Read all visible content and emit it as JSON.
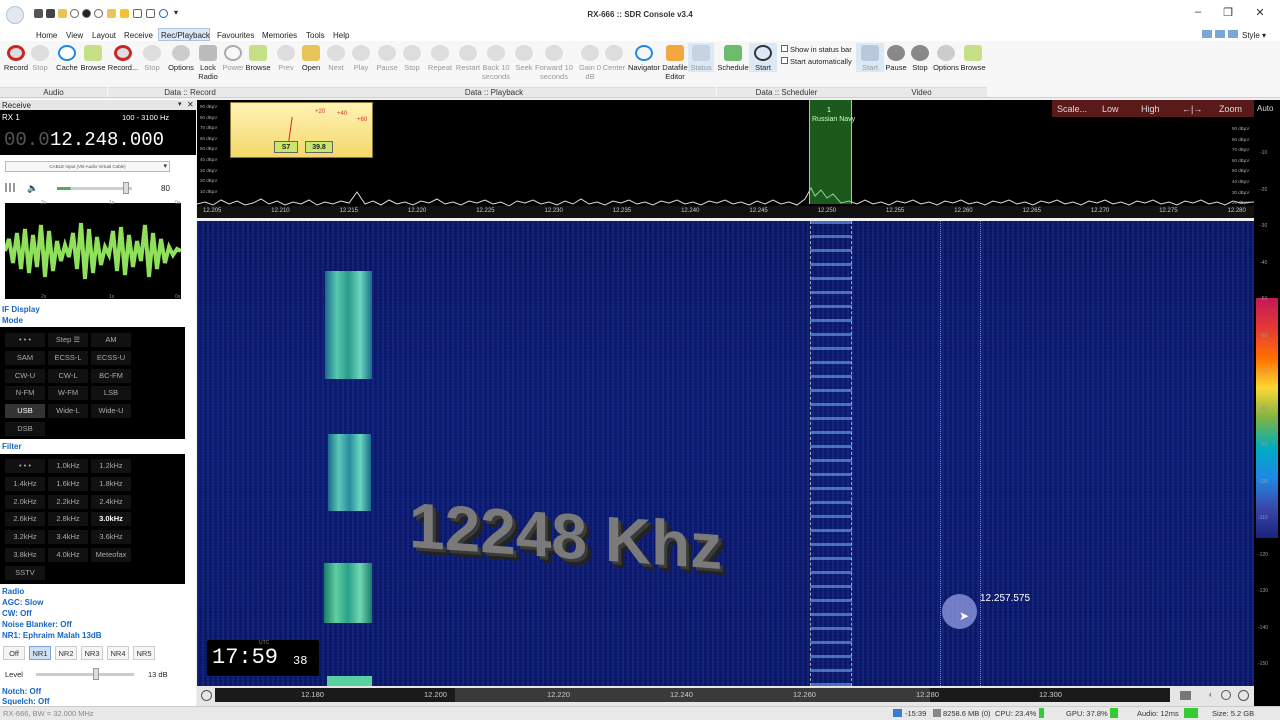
{
  "window": {
    "title": "RX-666 :: SDR Console v3.4",
    "style_label": "Style"
  },
  "menu": [
    "Home",
    "View",
    "Layout",
    "Receive",
    "Rec/Playback",
    "Favourites",
    "Memories",
    "Tools",
    "Help"
  ],
  "ribbon": {
    "audio": [
      "Record",
      "Stop",
      "Cache",
      "Browse"
    ],
    "data_record": [
      "Record...",
      "Stop",
      "Options",
      "Lock Radio",
      "Power",
      "Browse"
    ],
    "playback": [
      "Prev",
      "Open",
      "Next",
      "Play",
      "Pause",
      "Stop",
      "Repeat",
      "Restart",
      "Back 10 seconds",
      "Seek",
      "Forward 10 seconds",
      "Gain 0 dB",
      "Center",
      "Navigator",
      "Datafile Editor",
      "Status"
    ],
    "scheduler": [
      "Schedule",
      "Start"
    ],
    "scheduler_opts": [
      "Show in status bar",
      "Start automatically"
    ],
    "video": [
      "Start",
      "Pause",
      "Stop",
      "Options",
      "Browse"
    ],
    "groups": [
      "Audio",
      "Data :: Record",
      "Data :: Playback",
      "Data :: Scheduler",
      "Video"
    ]
  },
  "receive": {
    "panel_title": "Receive",
    "rx": "RX 1",
    "bw_range": "100 - 3100 Hz",
    "freq_dim": "00.0",
    "freq": "12.248.000",
    "audio_device": "CABLE Input (VB-Audio Virtual Cable)",
    "volume": "80",
    "scope_top": [
      "2s",
      "1s",
      "0s"
    ],
    "scope_bot": [
      "2s",
      "1s",
      "0s"
    ]
  },
  "sections": {
    "if_display": "IF Display",
    "mode": "Mode",
    "filter": "Filter",
    "radio": "Radio",
    "agc": "AGC: Slow",
    "cw": "CW: Off",
    "nb": "Noise Blanker: Off",
    "nr1": "NR1: Ephraim Malah 13dB",
    "notch": "Notch: Off",
    "squelch": "Squelch: Off"
  },
  "modes": [
    "• • •",
    "Step ☰",
    "AM",
    "SAM",
    "ECSS-L",
    "ECSS-U",
    "CW-U",
    "CW-L",
    "BC-FM",
    "N-FM",
    "W-FM",
    "LSB",
    "USB",
    "Wide-L",
    "Wide-U",
    "DSB"
  ],
  "filters": [
    "• • •",
    "1.0kHz",
    "1.2kHz",
    "1.4kHz",
    "1.6kHz",
    "1.8kHz",
    "2.0kHz",
    "2.2kHz",
    "2.4kHz",
    "2.6kHz",
    "2.8kHz",
    "3.0kHz",
    "3.2kHz",
    "3.4kHz",
    "3.6kHz",
    "3.8kHz",
    "4.0kHz",
    "Meteofax",
    "SSTV"
  ],
  "nr": {
    "buttons": [
      "Off",
      "NR1",
      "NR2",
      "NR3",
      "NR4",
      "NR5"
    ],
    "level_label": "Level",
    "level": "13 dB"
  },
  "smeter": {
    "ticks": [
      "+20",
      "+40",
      "+60"
    ],
    "s_value": "S7",
    "level": "39.8"
  },
  "spectrum": {
    "y_labels": [
      "90 dBµV",
      "80 dBµV",
      "70 dBµV",
      "60 dBµV",
      "50 dBµV",
      "40 dBµV",
      "30 dBµV",
      "20 dBµV",
      "10 dBµV"
    ],
    "freq_ticks": [
      "12.205",
      "12.210",
      "12.215",
      "12.220",
      "12.225",
      "12.230",
      "12.235",
      "12.240",
      "12.245",
      "12.250",
      "12.255",
      "12.260",
      "12.265",
      "12.270",
      "12.275",
      "12.280"
    ],
    "buttons": [
      "Scale...",
      "Low",
      "High",
      "←|→",
      "Zoom"
    ],
    "marker_num": "1",
    "marker_label": "Russian Navy",
    "auto": "Auto"
  },
  "waterfall": {
    "overlay": "12248 Khz",
    "cursor_freq": "12.257.575",
    "clock_main": "17:59",
    "clock_sec": "38",
    "clock_utc": "UTC",
    "bottom_ticks": [
      "12.180",
      "12.200",
      "12.220",
      "12.240",
      "12.260",
      "12.280",
      "12.300"
    ]
  },
  "right_scale": [
    "-10",
    "-20",
    "-30",
    "-40",
    "-50",
    "-60",
    "-70",
    "-80",
    "-90",
    "-100",
    "-110",
    "-120",
    "-130",
    "-140",
    "-150"
  ],
  "status": {
    "left": "RX-666, BW = 32.000 MHz",
    "time": "-15:39",
    "mem": "8258.6 MB (0)",
    "cpu": "CPU: 23.4%",
    "gpu": "GPU: 37.8%",
    "audio": "Audio: 12ms",
    "size": "Size: 5.2 GB"
  }
}
